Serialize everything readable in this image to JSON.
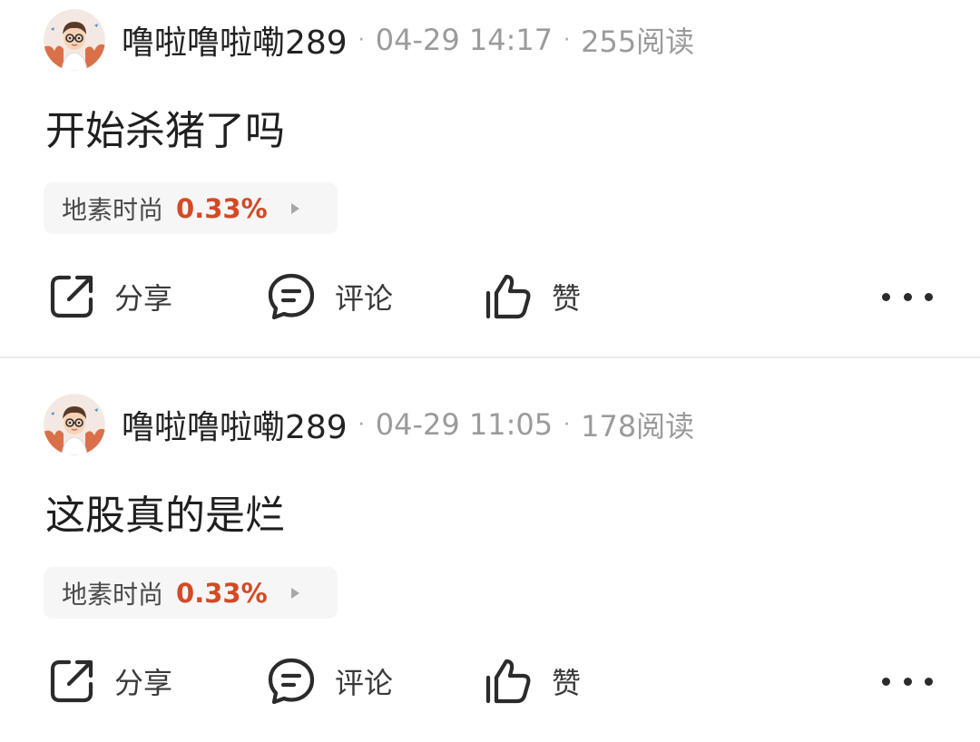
{
  "posts": [
    {
      "username": "噜啦噜啦嘞289",
      "separator": "·",
      "datetime": "04-29 14:17",
      "reads": "255阅读",
      "content": "开始杀猪了吗",
      "stock": {
        "name": "地素时尚",
        "change": "0.33%"
      },
      "actions": {
        "share": "分享",
        "comment": "评论",
        "like": "赞"
      }
    },
    {
      "username": "噜啦噜啦嘞289",
      "separator": "·",
      "datetime": "04-29 11:05",
      "reads": "178阅读",
      "content": "这股真的是烂",
      "stock": {
        "name": "地素时尚",
        "change": "0.33%"
      },
      "actions": {
        "share": "分享",
        "comment": "评论",
        "like": "赞"
      }
    }
  ],
  "colors": {
    "stock_up": "#d34a26",
    "divider": "#ebebeb",
    "tag_background": "#f6f6f6",
    "meta_text": "#9b9b9b"
  },
  "icons": {
    "share": "share-icon",
    "comment": "comment-icon",
    "like": "thumbs-up-icon",
    "more": "more-dots-icon"
  }
}
